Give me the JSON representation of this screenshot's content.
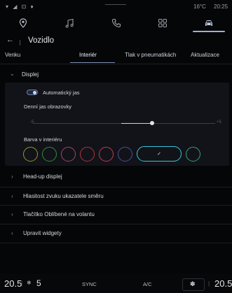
{
  "status": {
    "left_icons": "▾ ◢ ⊡ ♦",
    "temperature": "16°C",
    "time": "20:25"
  },
  "navbar": {
    "items": [
      {
        "icon": "location-pin-icon"
      },
      {
        "icon": "music-note-icon"
      },
      {
        "icon": "phone-icon"
      },
      {
        "icon": "apps-grid-icon"
      },
      {
        "icon": "car-icon",
        "active": true
      }
    ]
  },
  "header": {
    "back": "←",
    "title": "Vozidlo"
  },
  "tabs": [
    "Venku",
    "Interiér",
    "Tlak v pneumatikách",
    "Aktualizace"
  ],
  "active_tab": "Interiér",
  "displej": {
    "title": "Displej",
    "auto_brightness_label": "Automatický jas",
    "auto_brightness_on": true,
    "brightness_label": "Denní jas obrazovky",
    "slider_min": "-5",
    "slider_max": "+5",
    "slider_value": 1,
    "color_label": "Barva v interiéru",
    "swatch_colors": [
      "#8e9a2c",
      "#2f8d3a",
      "#a0456b",
      "#b4343b",
      "#c43a52",
      "#4c4fa2",
      "#39c5d6",
      "#3aa07c"
    ],
    "selected_swatch_check": "✓"
  },
  "rows": [
    {
      "label": "Head-up displej"
    },
    {
      "label": "Hlasitost zvuku ukazatele směru"
    },
    {
      "label": "Tlačítko Oblíbené na volantu"
    },
    {
      "label": "Upravit widgety"
    }
  ],
  "bottom": {
    "left_temp": "20.5",
    "fan_level": "5",
    "sync_label": "SYNC",
    "ac_label": "A/C",
    "right_temp": "20.5"
  }
}
